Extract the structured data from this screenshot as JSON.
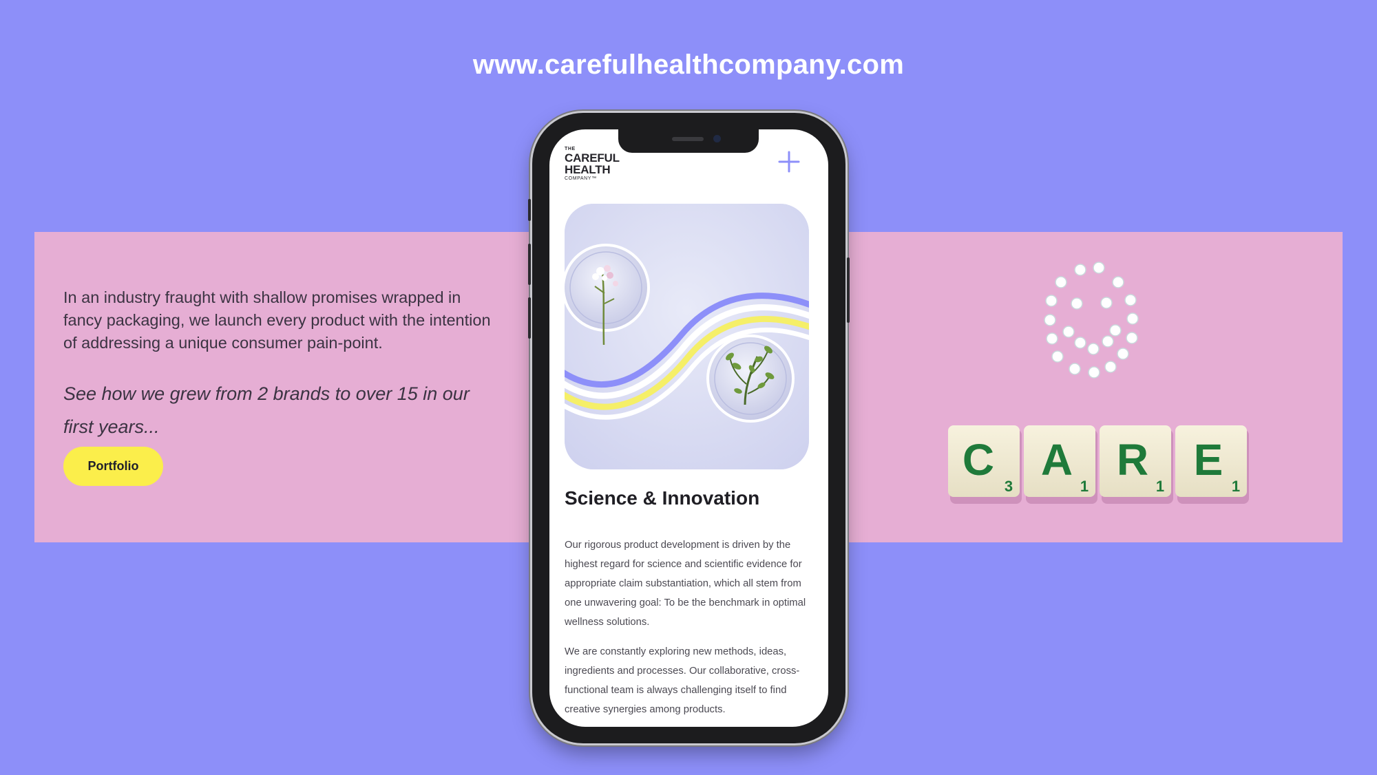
{
  "site_url": "www.carefulhealthcompany.com",
  "intro": {
    "text": "In an industry fraught with shallow promises wrapped in fancy packaging, we launch every product with the intention of addressing a unique consumer pain-point.",
    "tagline": "See how we grew from 2 brands to over 15 in our first years...",
    "portfolio_label": "Portfolio"
  },
  "phone": {
    "logo": {
      "the": "THE",
      "line1": "CAREFUL",
      "line2": "HEALTH",
      "company": "COMPANY™"
    },
    "section_title": "Science & Innovation",
    "paragraph1": "Our rigorous product development is driven by the highest regard for science and scientific evidence for appropriate claim substantiation, which all stem from one unwavering goal: To be the benchmark in optimal wellness solutions.",
    "paragraph2": "We are constantly exploring new methods, ideas, ingredients and processes. Our collaborative, cross-functional team is always challenging itself to find creative synergies among products."
  },
  "photo": {
    "tiles": [
      {
        "letter": "C",
        "score": "3"
      },
      {
        "letter": "A",
        "score": "1"
      },
      {
        "letter": "R",
        "score": "1"
      },
      {
        "letter": "E",
        "score": "1"
      }
    ]
  },
  "colors": {
    "background": "#8d8ff9",
    "band": "#e6aed4",
    "button": "#fbee4b",
    "accent": "#8d8ff9",
    "tile_letter": "#1f7a3a"
  },
  "icons": [
    "plus-icon"
  ]
}
